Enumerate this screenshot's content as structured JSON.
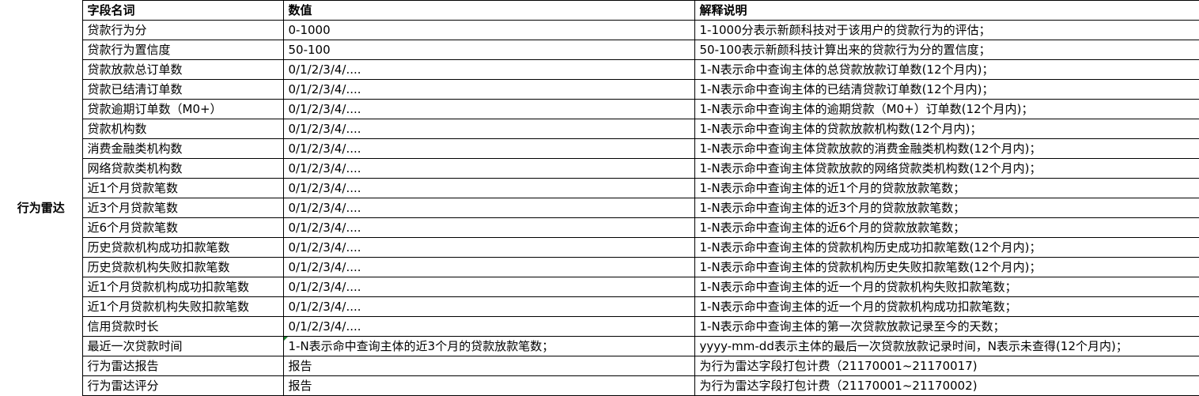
{
  "group_label": "行为雷达",
  "headers": {
    "field": "字段名词",
    "value": "数值",
    "desc": "解释说明"
  },
  "rows": [
    {
      "field": "贷款行为分",
      "value": "0-1000",
      "desc": "1-1000分表示新颜科技对于该用户的贷款行为的评估；"
    },
    {
      "field": "贷款行为置信度",
      "value": "50-100",
      "desc": "50-100表示新颜科技计算出来的贷款行为分的置信度；"
    },
    {
      "field": "贷款放款总订单数",
      "value": "0/1/2/3/4/....",
      "desc": "1-N表示命中查询主体的总贷款放款订单数(12个月内)；"
    },
    {
      "field": "贷款已结清订单数",
      "value": "0/1/2/3/4/....",
      "desc": "1-N表示命中查询主体的已结清贷款订单数(12个月内)；"
    },
    {
      "field": "贷款逾期订单数（M0+）",
      "value": "0/1/2/3/4/....",
      "desc": "1-N表示命中查询主体的逾期贷款（M0+）订单数(12个月内)；"
    },
    {
      "field": "贷款机构数",
      "value": "0/1/2/3/4/....",
      "desc": "1-N表示命中查询主体的贷款放款机构数(12个月内)；"
    },
    {
      "field": "消费金融类机构数",
      "value": "0/1/2/3/4/....",
      "desc": "1-N表示命中查询主体贷款放款的消费金融类机构数(12个月内)；"
    },
    {
      "field": "网络贷款类机构数",
      "value": "0/1/2/3/4/....",
      "desc": "1-N表示命中查询主体贷款放款的网络贷款类机构数(12个月内)；"
    },
    {
      "field": "近1个月贷款笔数",
      "value": "0/1/2/3/4/....",
      "desc": "1-N表示命中查询主体的近1个月的贷款放款笔数；"
    },
    {
      "field": "近3个月贷款笔数",
      "value": "0/1/2/3/4/....",
      "desc": "1-N表示命中查询主体的近3个月的贷款放款笔数；"
    },
    {
      "field": "近6个月贷款笔数",
      "value": "0/1/2/3/4/....",
      "desc": "1-N表示命中查询主体的近6个月的贷款放款笔数；"
    },
    {
      "field": "历史贷款机构成功扣款笔数",
      "value": "0/1/2/3/4/....",
      "desc": "1-N表示命中查询主体的贷款机构历史成功扣款笔数(12个月内)；"
    },
    {
      "field": "历史贷款机构失败扣款笔数",
      "value": "0/1/2/3/4/....",
      "desc": "1-N表示命中查询主体的贷款机构历史失败扣款笔数(12个月内)；"
    },
    {
      "field": "近1个月贷款机构成功扣款笔数",
      "value": "0/1/2/3/4/....",
      "desc": "1-N表示命中查询主体的近一个月的贷款机构失败扣款笔数；"
    },
    {
      "field": "近1个月贷款机构失败扣款笔数",
      "value": "0/1/2/3/4/....",
      "desc": "1-N表示命中查询主体的近一个月的贷款机构成功扣款笔数；"
    },
    {
      "field": "信用贷款时长",
      "value": "0/1/2/3/4/....",
      "desc": "1-N表示命中查询主体的第一次贷款放款记录至今的天数；"
    },
    {
      "field": "最近一次贷款时间",
      "value": "1-N表示命中查询主体的近3个月的贷款放款笔数；",
      "desc": "yyyy-mm-dd表示主体的最后一次贷款放款记录时间，N表示未查得(12个月内)；"
    },
    {
      "field": "行为雷达报告",
      "value": "报告",
      "desc": "为行为雷达字段打包计费（21170001~21170017)"
    },
    {
      "field": "行为雷达评分",
      "value": "报告",
      "desc": "为行为雷达字段打包计费（21170001~21170002)"
    }
  ]
}
